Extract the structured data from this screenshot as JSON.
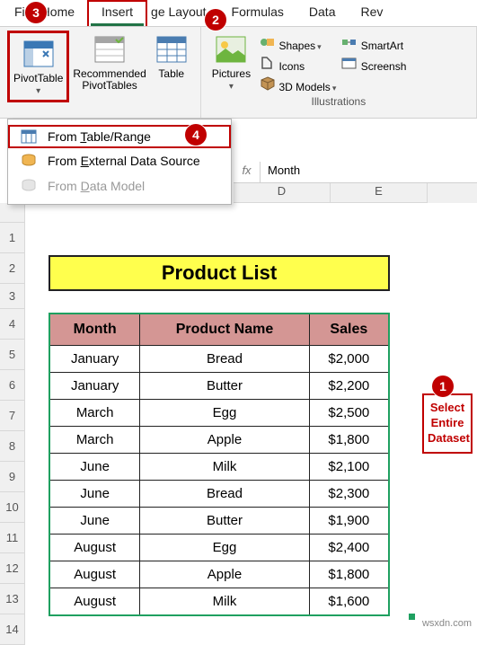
{
  "tabs": {
    "file": "Fi",
    "home": "Home",
    "insert": "Insert",
    "layout": "ge Layout",
    "formulas": "Formulas",
    "data": "Data",
    "review": "Rev"
  },
  "ribbon": {
    "pivot": "PivotTable",
    "recpivot": "Recommended\nPivotTables",
    "table": "Table",
    "pictures": "Pictures",
    "shapes": "Shapes",
    "icons": "Icons",
    "models": "3D Models",
    "smartart": "SmartArt",
    "screenshot": "Screensh",
    "illus_label": "Illustrations"
  },
  "dropdown": {
    "range": "From Table/Range",
    "external": "From External Data Source",
    "model": "From Data Model"
  },
  "formula": {
    "fx": "fx",
    "value": "Month"
  },
  "cols": {
    "d": "D",
    "e": "E"
  },
  "rows": [
    "1",
    "2",
    "3",
    "4",
    "5",
    "6",
    "7",
    "8",
    "9",
    "10",
    "11",
    "12",
    "13",
    "14"
  ],
  "list_title": "Product List",
  "headers": {
    "month": "Month",
    "product": "Product Name",
    "sales": "Sales"
  },
  "chart_data": {
    "type": "table",
    "columns": [
      "Month",
      "Product Name",
      "Sales"
    ],
    "rows": [
      [
        "January",
        "Bread",
        "$2,000"
      ],
      [
        "January",
        "Butter",
        "$2,200"
      ],
      [
        "March",
        "Egg",
        "$2,500"
      ],
      [
        "March",
        "Apple",
        "$1,800"
      ],
      [
        "June",
        "Milk",
        "$2,100"
      ],
      [
        "June",
        "Bread",
        "$2,300"
      ],
      [
        "June",
        "Butter",
        "$1,900"
      ],
      [
        "August",
        "Egg",
        "$2,400"
      ],
      [
        "August",
        "Apple",
        "$1,800"
      ],
      [
        "August",
        "Milk",
        "$1,600"
      ]
    ]
  },
  "callout": "Select\nEntire\nDataset",
  "badges": {
    "b1": "1",
    "b2": "2",
    "b3": "3",
    "b4": "4"
  },
  "watermark": "wsxdn.com"
}
